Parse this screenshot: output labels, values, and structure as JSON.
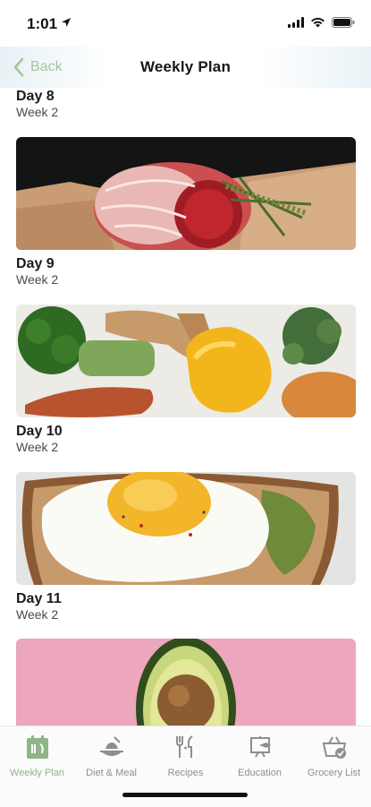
{
  "status_bar": {
    "time": "1:01"
  },
  "nav": {
    "back_label": "Back",
    "title": "Weekly Plan"
  },
  "days": [
    {
      "title": "Day 8",
      "week": "Week 2",
      "image": "raw-beef-roast-with-rosemary"
    },
    {
      "title": "Day 9",
      "week": "Week 2",
      "image": "vegetables-broccoli-ginger-peppers-sweet-potato"
    },
    {
      "title": "Day 10",
      "week": "Week 2",
      "image": "fried-egg-on-avocado-toast"
    },
    {
      "title": "Day 11",
      "week": "Week 2",
      "image": "halved-avocado-on-pink"
    }
  ],
  "tabs": [
    {
      "label": "Weekly Plan",
      "icon": "calendar-icon",
      "active": true
    },
    {
      "label": "Diet & Meal",
      "icon": "meal-icon",
      "active": false
    },
    {
      "label": "Recipes",
      "icon": "utensils-icon",
      "active": false
    },
    {
      "label": "Education",
      "icon": "education-icon",
      "active": false
    },
    {
      "label": "Grocery List",
      "icon": "basket-icon",
      "active": false
    }
  ],
  "colors": {
    "accent": "#8fb487",
    "back": "#a7c49c",
    "tab_inactive": "#8e8e8e"
  }
}
